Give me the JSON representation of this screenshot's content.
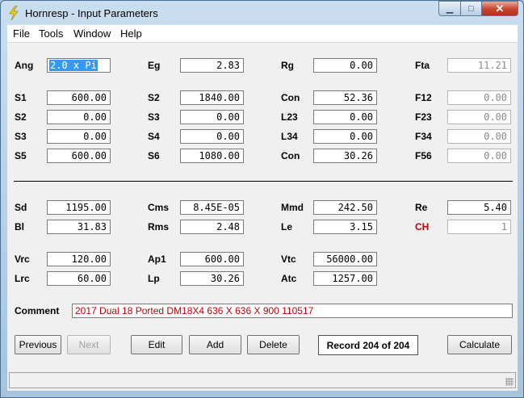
{
  "window": {
    "title": "Hornresp - Input Parameters",
    "minimize": "▁",
    "maximize": "□",
    "close": "✕",
    "icon": "lightning-bolt-icon"
  },
  "menu": [
    "File",
    "Tools",
    "Window",
    "Help"
  ],
  "fields": {
    "ang": {
      "label": "Ang",
      "value": "2.0 x Pi"
    },
    "eg": {
      "label": "Eg",
      "value": "2.83"
    },
    "rg": {
      "label": "Rg",
      "value": "0.00"
    },
    "fta": {
      "label": "Fta",
      "value": "11.21"
    },
    "s1": {
      "label": "S1",
      "value": "600.00"
    },
    "s2a": {
      "label": "S2",
      "value": "1840.00"
    },
    "con1": {
      "label": "Con",
      "value": "52.36"
    },
    "f12": {
      "label": "F12",
      "value": "0.00"
    },
    "s2b": {
      "label": "S2",
      "value": "0.00"
    },
    "s3a": {
      "label": "S3",
      "value": "0.00"
    },
    "l23": {
      "label": "L23",
      "value": "0.00"
    },
    "f23": {
      "label": "F23",
      "value": "0.00"
    },
    "s3b": {
      "label": "S3",
      "value": "0.00"
    },
    "s4": {
      "label": "S4",
      "value": "0.00"
    },
    "l34": {
      "label": "L34",
      "value": "0.00"
    },
    "f34": {
      "label": "F34",
      "value": "0.00"
    },
    "s5": {
      "label": "S5",
      "value": "600.00"
    },
    "s6": {
      "label": "S6",
      "value": "1080.00"
    },
    "con2": {
      "label": "Con",
      "value": "30.26"
    },
    "f56": {
      "label": "F56",
      "value": "0.00"
    },
    "sd": {
      "label": "Sd",
      "value": "1195.00"
    },
    "cms": {
      "label": "Cms",
      "value": "8.45E-05"
    },
    "mmd": {
      "label": "Mmd",
      "value": "242.50"
    },
    "re": {
      "label": "Re",
      "value": "5.40"
    },
    "bl": {
      "label": "Bl",
      "value": "31.83"
    },
    "rms": {
      "label": "Rms",
      "value": "2.48"
    },
    "le": {
      "label": "Le",
      "value": "3.15"
    },
    "ch": {
      "label": "CH",
      "value": "1"
    },
    "vrc": {
      "label": "Vrc",
      "value": "120.00"
    },
    "ap1": {
      "label": "Ap1",
      "value": "600.00"
    },
    "vtc": {
      "label": "Vtc",
      "value": "56000.00"
    },
    "lrc": {
      "label": "Lrc",
      "value": "60.00"
    },
    "lp": {
      "label": "Lp",
      "value": "30.26"
    },
    "atc": {
      "label": "Atc",
      "value": "1257.00"
    }
  },
  "comment": {
    "label": "Comment",
    "value": "2017 Dual 18 Ported DM18X4 636 X 636 X 900 110517"
  },
  "buttons": {
    "previous": "Previous",
    "next": "Next",
    "edit": "Edit",
    "add": "Add",
    "delete": "Delete",
    "calculate": "Calculate"
  },
  "record": "Record 204 of 204",
  "colors": {
    "accent_red": "#c00000",
    "selection": "#3399ff"
  }
}
